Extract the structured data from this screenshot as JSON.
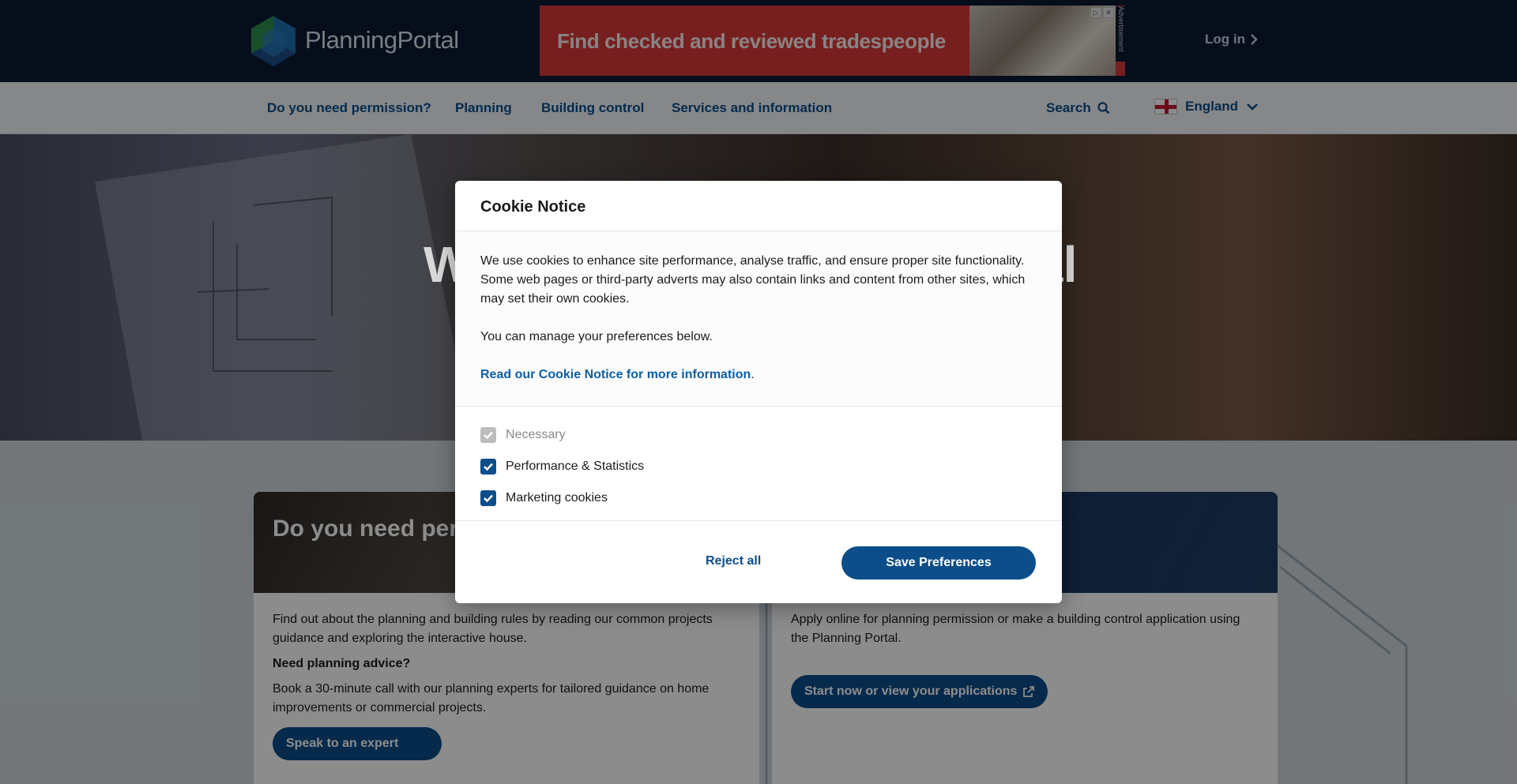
{
  "header": {
    "logo_text": "PlanningPortal",
    "ad_text": "Find checked and reviewed tradespeople",
    "ad_label": "Advertisement",
    "login_label": "Log in"
  },
  "nav": {
    "items": [
      {
        "label": "Do you need permission?"
      },
      {
        "label": "Planning"
      },
      {
        "label": "Building control"
      },
      {
        "label": "Services and information"
      }
    ],
    "search_label": "Search",
    "region_label": "England"
  },
  "hero": {
    "title_start": "W",
    "title_end": "al"
  },
  "cards": {
    "left": {
      "title": "Do you need per",
      "text1": "Find out about the planning and building rules by reading our common projects guidance and exploring the interactive house.",
      "heading": "Need planning advice?",
      "text2": "Book a 30-minute call with our planning experts for tailored guidance on home improvements or commercial projects.",
      "button": "Speak to an expert"
    },
    "right": {
      "text1": "Apply online for planning permission or make a building control application using the Planning Portal.",
      "button": "Start now or view your applications"
    }
  },
  "modal": {
    "title": "Cookie Notice",
    "para1": "We use cookies to enhance site performance, analyse traffic, and ensure proper site functionality. Some web pages or third-party adverts may also contain links and content from other sites, which may set their own cookies.",
    "para2": "You can manage your preferences below.",
    "link_text": "Read our Cookie Notice for more information",
    "link_suffix": ".",
    "options": [
      {
        "label": "Necessary",
        "checked": true,
        "disabled": true
      },
      {
        "label": "Performance & Statistics",
        "checked": true,
        "disabled": false
      },
      {
        "label": "Marketing cookies",
        "checked": true,
        "disabled": false
      }
    ],
    "reject_label": "Reject all",
    "save_label": "Save Preferences"
  },
  "colors": {
    "brand_navy": "#0b1a33",
    "link_blue": "#0b4e8a",
    "ad_red": "#d93a3a"
  }
}
